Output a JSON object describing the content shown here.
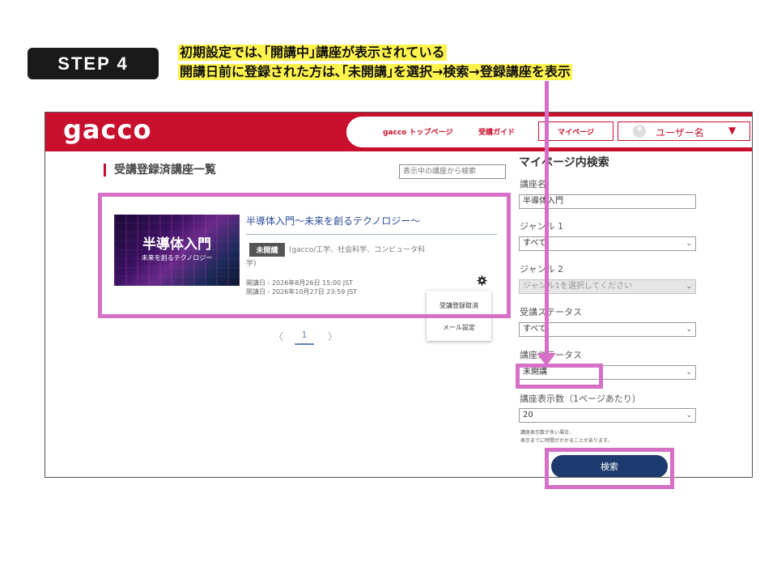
{
  "step_label": "STEP 4",
  "instructions": {
    "line1": "初期設定では､｢開講中｣講座が表示されている",
    "line2": "開講日前に登録された方は､｢未開講｣を選択→検索→登録講座を表示"
  },
  "header": {
    "logo": "gacco",
    "nav_top": "gacco トップページ",
    "nav_guide": "受講ガイド",
    "mypage": "マイページ",
    "user_name": "ユーザー名",
    "user_caret": "▼"
  },
  "main": {
    "section_title": "受講登録済講座一覧",
    "search_placeholder": "表示中の講座から検索",
    "course": {
      "thumb_title": "半導体入門",
      "thumb_subtitle": "未来を創るテクノロジー",
      "title": "半導体入門～未来を創るテクノロジー～",
      "status": "未開講",
      "category": "(gacco/工学、社会科学、コンピュータ科学)",
      "open_date": "開講日 - 2026年8月26日 15:00 JST",
      "close_date": "閉講日 - 2026年10月27日 23:59 JST"
    },
    "menu": {
      "unregister": "受講登録取消",
      "mail_settings": "メール設定"
    },
    "pager": {
      "prev": "〈",
      "page": "1",
      "next": "〉"
    }
  },
  "panel": {
    "title": "マイページ内検索",
    "name_label": "講座名",
    "name_value": "半導体入門",
    "genre1_label": "ジャンル 1",
    "genre1_value": "すべて",
    "genre2_label": "ジャンル 2",
    "genre2_value": "ジャンル1を選択してください",
    "attend_label": "受講ステータス",
    "attend_value": "すべて",
    "course_label": "講座ステータス",
    "course_value": "未開講",
    "count_label": "講座表示数（1ページあたり）",
    "count_value": "20",
    "note1": "講座表示数が多い場合、",
    "note2": "表示までに時間がかかることがあります。",
    "search_button": "検索",
    "caret": "⌄"
  },
  "colors": {
    "brand_red": "#c8102e",
    "highlight": "#d570c6",
    "instruction_bg": "#fff34d",
    "button_navy": "#1d3a6e"
  }
}
